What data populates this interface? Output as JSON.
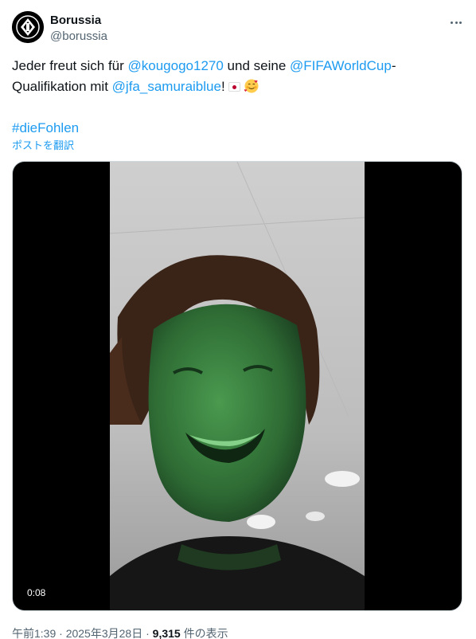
{
  "author": {
    "display_name": "Borussia",
    "handle": "@borussia",
    "avatar_icon": "borussia-crest-icon"
  },
  "more_icon": "more-horizontal-icon",
  "tweet": {
    "line1": {
      "t1": "Jeder freut sich für ",
      "mention1": "@kougogo1270",
      "t2": " und seine ",
      "mention2": "@FIFAWorldCup",
      "t3": "-"
    },
    "line2": {
      "t1": "Qualifikation mit ",
      "mention3": "@jfa_samuraiblue",
      "t2": "!",
      "emoji1": "japan-flag-icon",
      "emoji2": "smiling-face-with-hearts-icon"
    },
    "hashtag": "#dieFohlen"
  },
  "translate_label": "ポストを翻訳",
  "media": {
    "type": "video",
    "timecode": "0:08"
  },
  "meta": {
    "time": "午前1:39",
    "sep1": " · ",
    "date": "2025年3月28日",
    "sep2": " · ",
    "views": "9,315",
    "views_label": " 件の表示"
  }
}
